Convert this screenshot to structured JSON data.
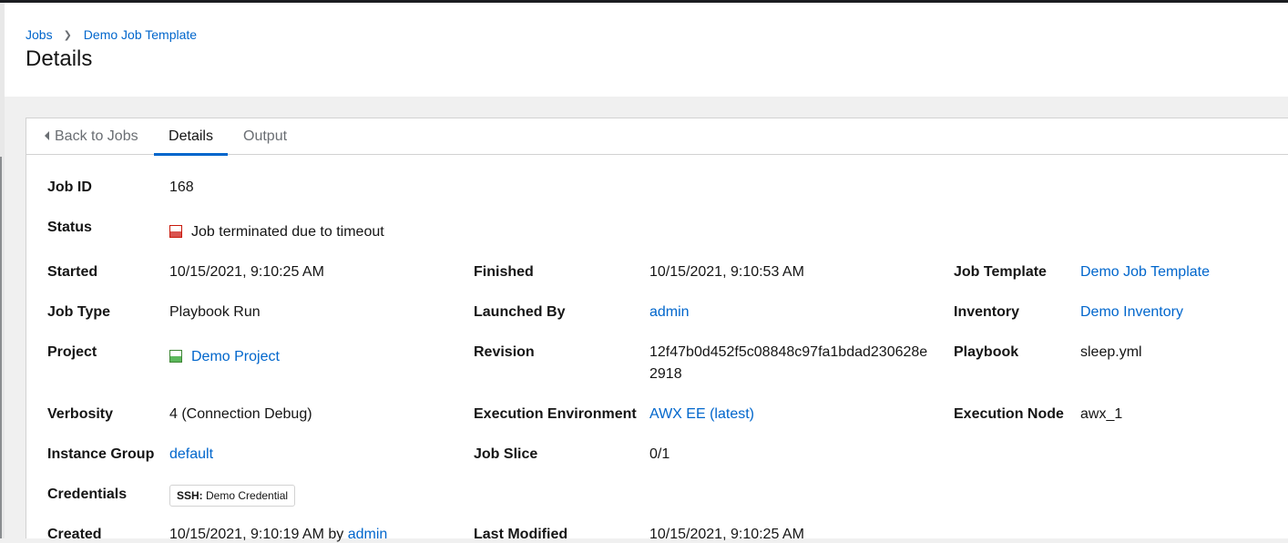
{
  "breadcrumb": {
    "jobs": "Jobs",
    "template": "Demo Job Template"
  },
  "page_title": "Details",
  "tabs": {
    "back": "Back to Jobs",
    "details": "Details",
    "output": "Output"
  },
  "details": {
    "job_id": {
      "label": "Job ID",
      "value": "168"
    },
    "status": {
      "label": "Status",
      "value": "Job terminated due to timeout",
      "color": "#d9534f"
    },
    "started": {
      "label": "Started",
      "value": "10/15/2021, 9:10:25 AM"
    },
    "finished": {
      "label": "Finished",
      "value": "10/15/2021, 9:10:53 AM"
    },
    "job_template": {
      "label": "Job Template",
      "value": "Demo Job Template"
    },
    "job_type": {
      "label": "Job Type",
      "value": "Playbook Run"
    },
    "launched_by": {
      "label": "Launched By",
      "value": "admin"
    },
    "inventory": {
      "label": "Inventory",
      "value": "Demo Inventory"
    },
    "project": {
      "label": "Project",
      "value": "Demo Project",
      "color": "#5cb85c"
    },
    "revision": {
      "label": "Revision",
      "value": "12f47b0d452f5c08848c97fa1bdad230628e2918"
    },
    "playbook": {
      "label": "Playbook",
      "value": "sleep.yml"
    },
    "verbosity": {
      "label": "Verbosity",
      "value": "4 (Connection Debug)"
    },
    "execution_environment": {
      "label": "Execution Environment",
      "value": "AWX EE (latest)"
    },
    "execution_node": {
      "label": "Execution Node",
      "value": "awx_1"
    },
    "instance_group": {
      "label": "Instance Group",
      "value": "default"
    },
    "job_slice": {
      "label": "Job Slice",
      "value": "0/1"
    },
    "credentials": {
      "label": "Credentials",
      "kind": "SSH:",
      "name": "Demo Credential"
    },
    "created": {
      "label": "Created",
      "value": "10/15/2021, 9:10:19 AM by ",
      "by": "admin"
    },
    "last_modified": {
      "label": "Last Modified",
      "value": "10/15/2021, 9:10:25 AM"
    }
  },
  "colors": {
    "link": "#0066cc",
    "text": "#151515",
    "muted": "#6a6e73"
  }
}
